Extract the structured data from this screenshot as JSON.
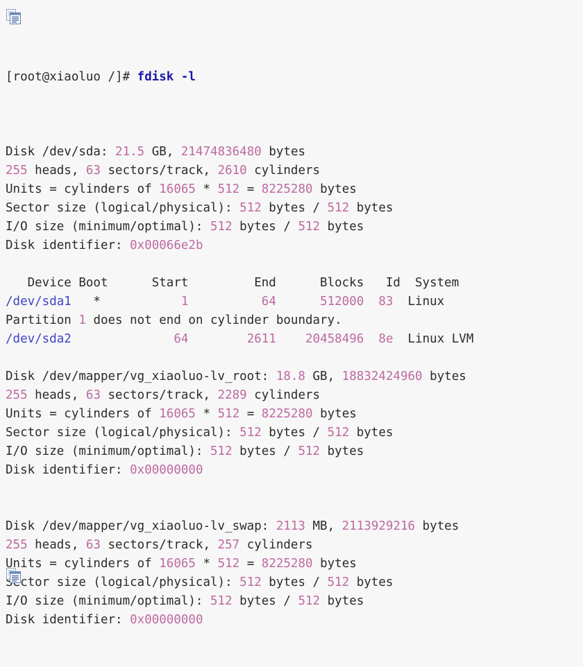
{
  "page": {
    "background_color": "#f7f7f7",
    "watermark": "松勤软件学院"
  },
  "icons": {
    "copy_top": "copy-icon",
    "copy_bottom": "copy-icon"
  },
  "colors": {
    "plain_text": "#2b2b2b",
    "number": "#bd6aa0",
    "device_path": "#4242c8",
    "command": "#1a1aaa"
  },
  "terminal": {
    "prompt": "[root@xiaoluo /]# ",
    "command": "fdisk -l",
    "lines": [
      {
        "type": "blank"
      },
      {
        "type": "text",
        "parts": [
          {
            "t": "Disk /dev/sda: ",
            "c": "plain"
          },
          {
            "t": "21.5",
            "c": "num"
          },
          {
            "t": " GB, ",
            "c": "plain"
          },
          {
            "t": "21474836480",
            "c": "num"
          },
          {
            "t": " bytes",
            "c": "plain"
          }
        ]
      },
      {
        "type": "text",
        "parts": [
          {
            "t": "255",
            "c": "num"
          },
          {
            "t": " heads, ",
            "c": "plain"
          },
          {
            "t": "63",
            "c": "num"
          },
          {
            "t": " sectors/track, ",
            "c": "plain"
          },
          {
            "t": "2610",
            "c": "num"
          },
          {
            "t": " cylinders",
            "c": "plain"
          }
        ]
      },
      {
        "type": "text",
        "parts": [
          {
            "t": "Units = cylinders of ",
            "c": "plain"
          },
          {
            "t": "16065",
            "c": "num"
          },
          {
            "t": " * ",
            "c": "plain"
          },
          {
            "t": "512",
            "c": "num"
          },
          {
            "t": " = ",
            "c": "plain"
          },
          {
            "t": "8225280",
            "c": "num"
          },
          {
            "t": " bytes",
            "c": "plain"
          }
        ]
      },
      {
        "type": "text",
        "parts": [
          {
            "t": "Sector size (logical/physical): ",
            "c": "plain"
          },
          {
            "t": "512",
            "c": "num"
          },
          {
            "t": " bytes / ",
            "c": "plain"
          },
          {
            "t": "512",
            "c": "num"
          },
          {
            "t": " bytes",
            "c": "plain"
          }
        ]
      },
      {
        "type": "text",
        "parts": [
          {
            "t": "I/O size (minimum/optimal): ",
            "c": "plain"
          },
          {
            "t": "512",
            "c": "num"
          },
          {
            "t": " bytes / ",
            "c": "plain"
          },
          {
            "t": "512",
            "c": "num"
          },
          {
            "t": " bytes",
            "c": "plain"
          }
        ]
      },
      {
        "type": "text",
        "parts": [
          {
            "t": "Disk identifier: ",
            "c": "plain"
          },
          {
            "t": "0x00066e2b",
            "c": "num"
          }
        ]
      },
      {
        "type": "blank"
      },
      {
        "type": "text",
        "parts": [
          {
            "t": "   Device Boot      Start         End      Blocks   Id  System",
            "c": "plain"
          }
        ]
      },
      {
        "type": "text",
        "parts": [
          {
            "t": "/dev/sda1",
            "c": "path"
          },
          {
            "t": "   *           ",
            "c": "plain"
          },
          {
            "t": "1",
            "c": "num"
          },
          {
            "t": "          ",
            "c": "plain"
          },
          {
            "t": "64",
            "c": "num"
          },
          {
            "t": "      ",
            "c": "plain"
          },
          {
            "t": "512000",
            "c": "num"
          },
          {
            "t": "  ",
            "c": "plain"
          },
          {
            "t": "83",
            "c": "num"
          },
          {
            "t": "  Linux",
            "c": "plain"
          }
        ]
      },
      {
        "type": "text",
        "parts": [
          {
            "t": "Partition ",
            "c": "plain"
          },
          {
            "t": "1",
            "c": "num"
          },
          {
            "t": " does not end on cylinder boundary.",
            "c": "plain"
          }
        ]
      },
      {
        "type": "text",
        "parts": [
          {
            "t": "/dev/sda2",
            "c": "path"
          },
          {
            "t": "              ",
            "c": "plain"
          },
          {
            "t": "64",
            "c": "num"
          },
          {
            "t": "        ",
            "c": "plain"
          },
          {
            "t": "2611",
            "c": "num"
          },
          {
            "t": "    ",
            "c": "plain"
          },
          {
            "t": "20458496",
            "c": "num"
          },
          {
            "t": "  ",
            "c": "plain"
          },
          {
            "t": "8e",
            "c": "num"
          },
          {
            "t": "  Linux LVM",
            "c": "plain"
          }
        ]
      },
      {
        "type": "blank"
      },
      {
        "type": "text",
        "parts": [
          {
            "t": "Disk /dev/mapper/vg_xiaoluo-lv_root: ",
            "c": "plain"
          },
          {
            "t": "18.8",
            "c": "num"
          },
          {
            "t": " GB, ",
            "c": "plain"
          },
          {
            "t": "18832424960",
            "c": "num"
          },
          {
            "t": " bytes",
            "c": "plain"
          }
        ]
      },
      {
        "type": "text",
        "parts": [
          {
            "t": "255",
            "c": "num"
          },
          {
            "t": " heads, ",
            "c": "plain"
          },
          {
            "t": "63",
            "c": "num"
          },
          {
            "t": " sectors/track, ",
            "c": "plain"
          },
          {
            "t": "2289",
            "c": "num"
          },
          {
            "t": " cylinders",
            "c": "plain"
          }
        ]
      },
      {
        "type": "text",
        "parts": [
          {
            "t": "Units = cylinders of ",
            "c": "plain"
          },
          {
            "t": "16065",
            "c": "num"
          },
          {
            "t": " * ",
            "c": "plain"
          },
          {
            "t": "512",
            "c": "num"
          },
          {
            "t": " = ",
            "c": "plain"
          },
          {
            "t": "8225280",
            "c": "num"
          },
          {
            "t": " bytes",
            "c": "plain"
          }
        ]
      },
      {
        "type": "text",
        "parts": [
          {
            "t": "Sector size (logical/physical): ",
            "c": "plain"
          },
          {
            "t": "512",
            "c": "num"
          },
          {
            "t": " bytes / ",
            "c": "plain"
          },
          {
            "t": "512",
            "c": "num"
          },
          {
            "t": " bytes",
            "c": "plain"
          }
        ]
      },
      {
        "type": "text",
        "parts": [
          {
            "t": "I/O size (minimum/optimal): ",
            "c": "plain"
          },
          {
            "t": "512",
            "c": "num"
          },
          {
            "t": " bytes / ",
            "c": "plain"
          },
          {
            "t": "512",
            "c": "num"
          },
          {
            "t": " bytes",
            "c": "plain"
          }
        ]
      },
      {
        "type": "text",
        "parts": [
          {
            "t": "Disk identifier: ",
            "c": "plain"
          },
          {
            "t": "0x00000000",
            "c": "num"
          }
        ]
      },
      {
        "type": "blank"
      },
      {
        "type": "blank"
      },
      {
        "type": "text",
        "parts": [
          {
            "t": "Disk /dev/mapper/vg_xiaoluo-lv_swap: ",
            "c": "plain"
          },
          {
            "t": "2113",
            "c": "num"
          },
          {
            "t": " MB, ",
            "c": "plain"
          },
          {
            "t": "2113929216",
            "c": "num"
          },
          {
            "t": " bytes",
            "c": "plain"
          }
        ]
      },
      {
        "type": "text",
        "parts": [
          {
            "t": "255",
            "c": "num"
          },
          {
            "t": " heads, ",
            "c": "plain"
          },
          {
            "t": "63",
            "c": "num"
          },
          {
            "t": " sectors/track, ",
            "c": "plain"
          },
          {
            "t": "257",
            "c": "num"
          },
          {
            "t": " cylinders",
            "c": "plain"
          }
        ]
      },
      {
        "type": "text",
        "parts": [
          {
            "t": "Units = cylinders of ",
            "c": "plain"
          },
          {
            "t": "16065",
            "c": "num"
          },
          {
            "t": " * ",
            "c": "plain"
          },
          {
            "t": "512",
            "c": "num"
          },
          {
            "t": " = ",
            "c": "plain"
          },
          {
            "t": "8225280",
            "c": "num"
          },
          {
            "t": " bytes",
            "c": "plain"
          }
        ]
      },
      {
        "type": "text",
        "parts": [
          {
            "t": "Sector size (logical/physical): ",
            "c": "plain"
          },
          {
            "t": "512",
            "c": "num"
          },
          {
            "t": " bytes / ",
            "c": "plain"
          },
          {
            "t": "512",
            "c": "num"
          },
          {
            "t": " bytes",
            "c": "plain"
          }
        ]
      },
      {
        "type": "text",
        "parts": [
          {
            "t": "I/O size (minimum/optimal): ",
            "c": "plain"
          },
          {
            "t": "512",
            "c": "num"
          },
          {
            "t": " bytes / ",
            "c": "plain"
          },
          {
            "t": "512",
            "c": "num"
          },
          {
            "t": " bytes",
            "c": "plain"
          }
        ]
      },
      {
        "type": "text",
        "parts": [
          {
            "t": "Disk identifier: ",
            "c": "plain"
          },
          {
            "t": "0x00000000",
            "c": "num"
          }
        ]
      }
    ]
  }
}
